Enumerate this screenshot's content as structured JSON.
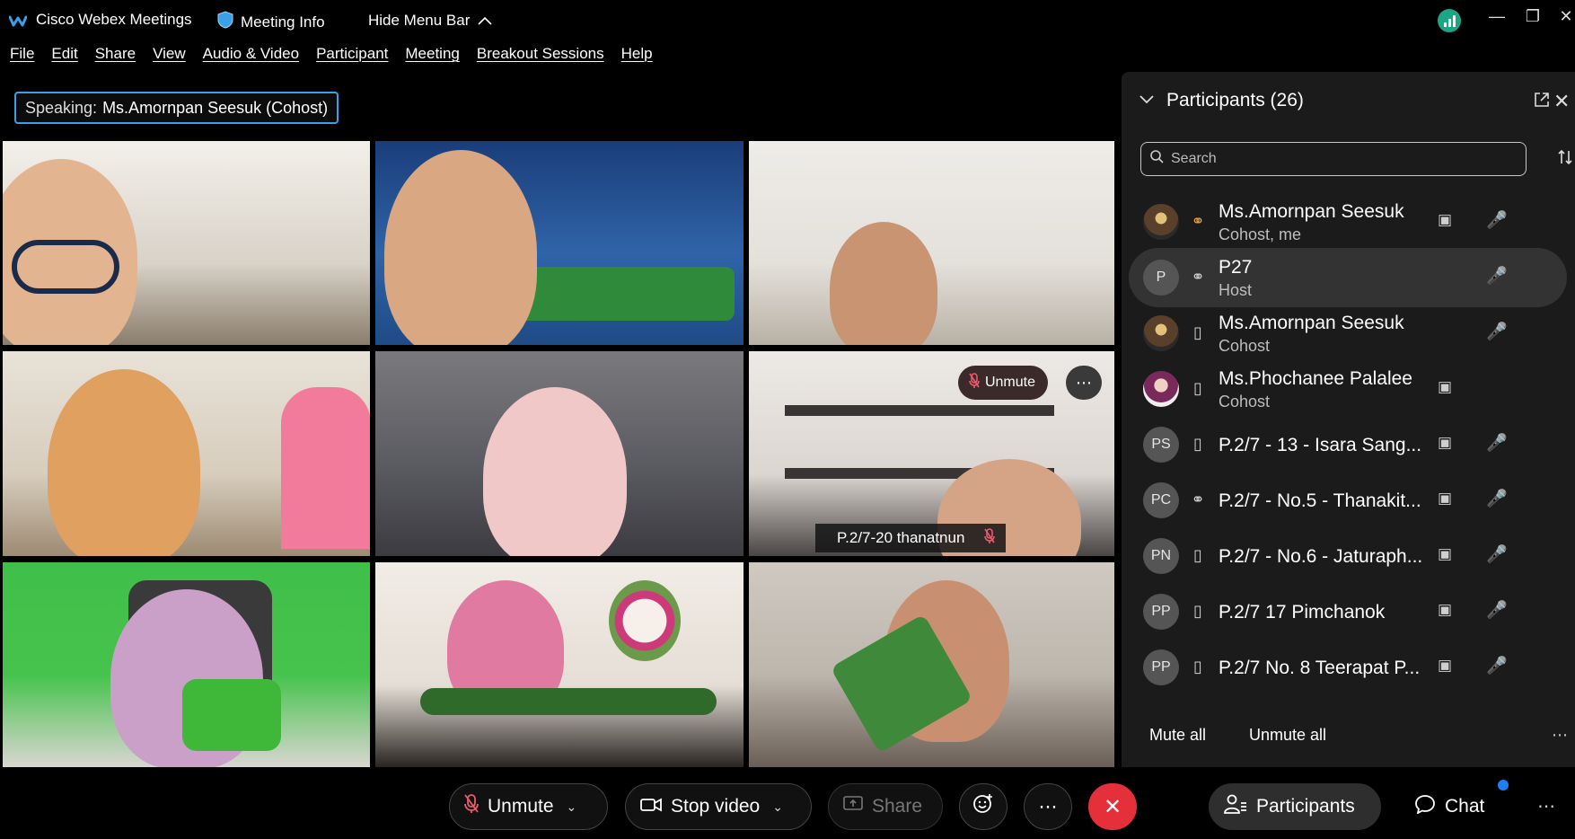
{
  "titlebar": {
    "app_title": "Cisco Webex Meetings",
    "meeting_info": "Meeting Info",
    "hide_menu_bar": "Hide Menu Bar"
  },
  "menu": [
    "File",
    "Edit",
    "Share",
    "View",
    "Audio & Video",
    "Participant",
    "Meeting",
    "Breakout Sessions",
    "Help"
  ],
  "speaking": {
    "label": "Speaking:",
    "name": "Ms.Amornpan Seesuk (Cohost)"
  },
  "video_tiles": [
    {
      "unmute_label": "Unmute",
      "more_label": "⋯",
      "name_tag": "P.2/7-20 thanatnun"
    }
  ],
  "participants_panel": {
    "title": "Participants (26)",
    "search_placeholder": "Search",
    "participants": [
      {
        "avatar": "",
        "name": "Ms.Amornpan Seesuk",
        "role": "Cohost, me",
        "device": "headset-icon",
        "video": true,
        "mic": "muted"
      },
      {
        "avatar": "P",
        "name": "P27",
        "role": "Host",
        "device": "headset-icon",
        "video": false,
        "mic": "muted"
      },
      {
        "avatar": "",
        "name": "Ms.Amornpan Seesuk",
        "role": "Cohost",
        "device": "mobile-icon",
        "video": false,
        "mic": "on"
      },
      {
        "avatar": "",
        "name": "Ms.Phochanee Palalee",
        "role": "Cohost",
        "device": "mobile-icon",
        "video": true,
        "mic": "none"
      },
      {
        "avatar": "PS",
        "name": "P.2/7 - 13 - Isara Sang...",
        "role": "",
        "device": "mobile-icon",
        "video": true,
        "mic": "muted"
      },
      {
        "avatar": "PC",
        "name": "P.2/7 - No.5 - Thanakit...",
        "role": "",
        "device": "headset-icon",
        "video": true,
        "mic": "muted"
      },
      {
        "avatar": "PN",
        "name": "P.2/7 - No.6 - Jaturaph...",
        "role": "",
        "device": "mobile-icon",
        "video": true,
        "mic": "muted"
      },
      {
        "avatar": "PP",
        "name": "P.2/7 17 Pimchanok",
        "role": "",
        "device": "mobile-icon",
        "video": true,
        "mic": "muted"
      },
      {
        "avatar": "PP",
        "name": "P.2/7 No. 8 Teerapat P...",
        "role": "",
        "device": "mobile-icon",
        "video": true,
        "mic": "muted"
      }
    ],
    "mute_all": "Mute all",
    "unmute_all": "Unmute all"
  },
  "controls": {
    "unmute": "Unmute",
    "stop_video": "Stop video",
    "share": "Share",
    "participants": "Participants",
    "chat": "Chat"
  },
  "colors": {
    "accent": "#3aa0e8",
    "leave": "#e5303a",
    "muted": "#ee5a6c",
    "mic_on": "#1fbf8a"
  }
}
